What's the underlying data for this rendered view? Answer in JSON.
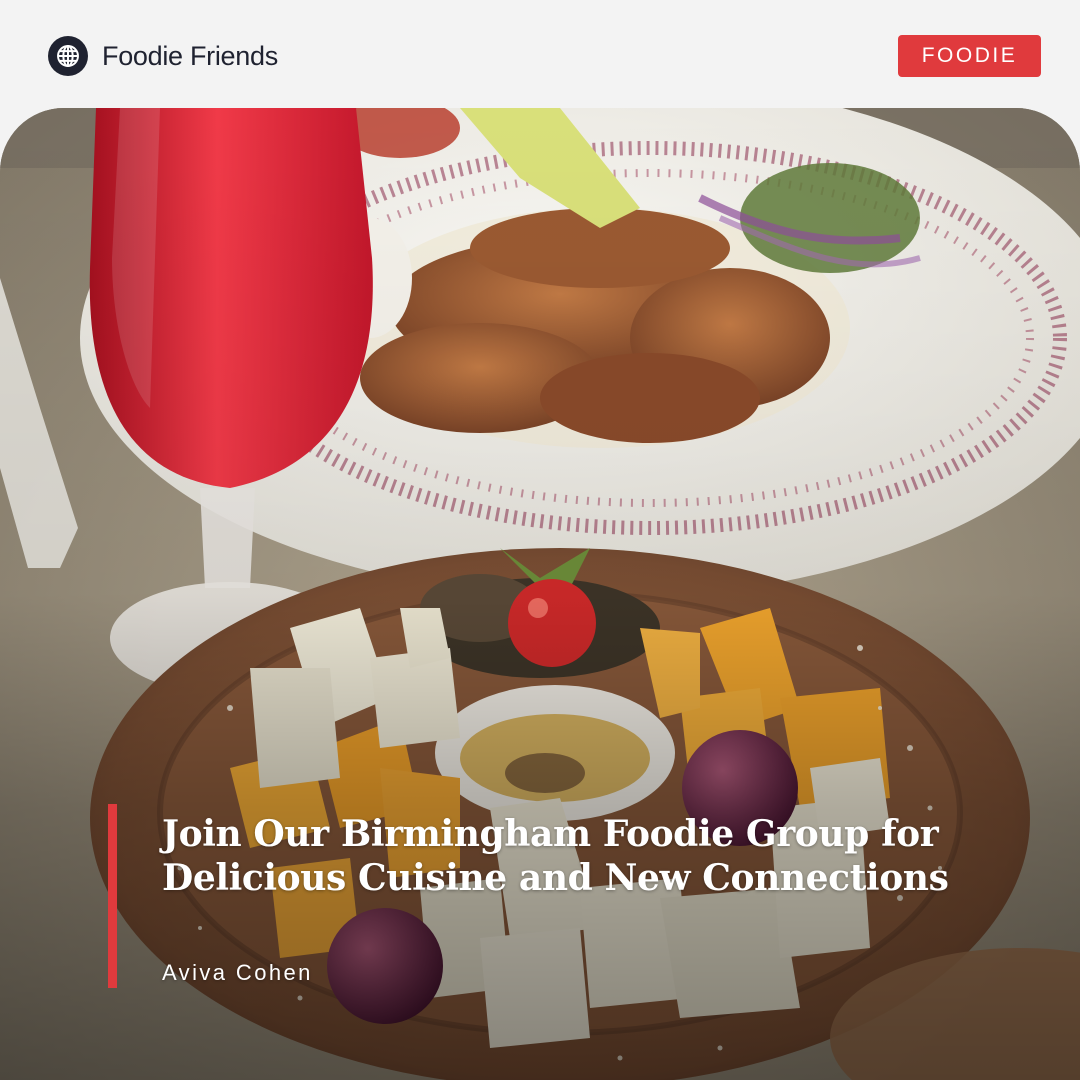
{
  "header": {
    "brand_name": "Foodie Friends",
    "brand_icon": "globe-icon",
    "tag_label": "FOODIE"
  },
  "post": {
    "title": "Join Our Birmingham Foodie Group for Delicious Cuisine and New Connections",
    "author": "Aviva Cohen"
  },
  "colors": {
    "accent": "#e03a3d",
    "brand_dark": "#1f2230",
    "background": "#f3f3f3"
  }
}
